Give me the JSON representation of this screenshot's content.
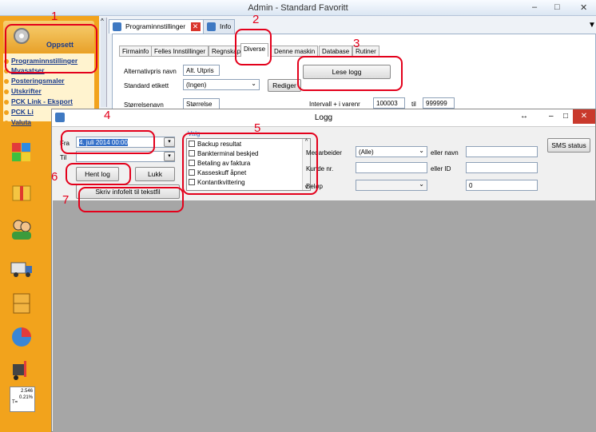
{
  "window": {
    "title": "Admin - Standard Favoritt",
    "controls": [
      "–",
      "□",
      "✕"
    ]
  },
  "sidebar": {
    "header": "Oppsett",
    "items": [
      "Programinnstillinger",
      "Mvasatser",
      "Posteringsmaler",
      "Utskrifter",
      "PCK Link - Eksport",
      "PCK Li",
      "Valuta"
    ],
    "icons": [
      "puzzle-icon",
      "box-icon",
      "users-icon",
      "truck-icon",
      "cabinet-icon",
      "chart-icon",
      "forklift-icon",
      "calculator-icon"
    ],
    "calc": {
      "line1": "2.546",
      "line2": "0.21%",
      "line3": "T="
    }
  },
  "tabs": [
    {
      "label": "Programinnstillinger",
      "active": true
    },
    {
      "label": "Info",
      "active": false
    }
  ],
  "subtabs": [
    "Firmainfo",
    "Felles Innstillinger",
    "Regnskap",
    "Diverse",
    "Denne maskin",
    "Database",
    "Rutiner"
  ],
  "settings": {
    "altpris_label": "Alternativpris navn",
    "altpris_value": "Alt. Utpris",
    "etikett_label": "Standard etikett",
    "etikett_value": "(Ingen)",
    "rediger_label": "Rediger",
    "storrelse_label": "Størrelsenavn",
    "storrelse_value": "Størrelse",
    "lese_logg_label": "Lese logg",
    "intervall_label": "Intervall + i varenr",
    "intervall_from": "100003",
    "til_label": "til",
    "intervall_to": "999999"
  },
  "log": {
    "title": "Logg",
    "fra_label": "Fra",
    "fra_value": "4. juli 2014 00:00",
    "til_label": "Til",
    "til_value": "",
    "hent_log": "Hent log",
    "lukk": "Lukk",
    "skriv": "Skriv infofelt til tekstfil",
    "group_label": "Valg",
    "checkbox_items": [
      "Backup resultat",
      "Bankterminal beskjed",
      "Betaling av faktura",
      "Kasseskuff åpnet",
      "Kontantkvittering"
    ],
    "medarbeider_label": "Medarbeider",
    "medarbeider_value": "(Alle)",
    "eller_navn": "eller navn",
    "kunde_label": "Kunde nr.",
    "eller_id": "eller ID",
    "belop_label": "Beløp",
    "belop_value": "0",
    "sms_status": "SMS status"
  },
  "annotations": [
    "1",
    "2",
    "3",
    "4",
    "5",
    "6",
    "7"
  ],
  "colors": {
    "annotation": "#e3001b",
    "sidebar": "#f2a31c",
    "grid": "#a6a6a6"
  }
}
